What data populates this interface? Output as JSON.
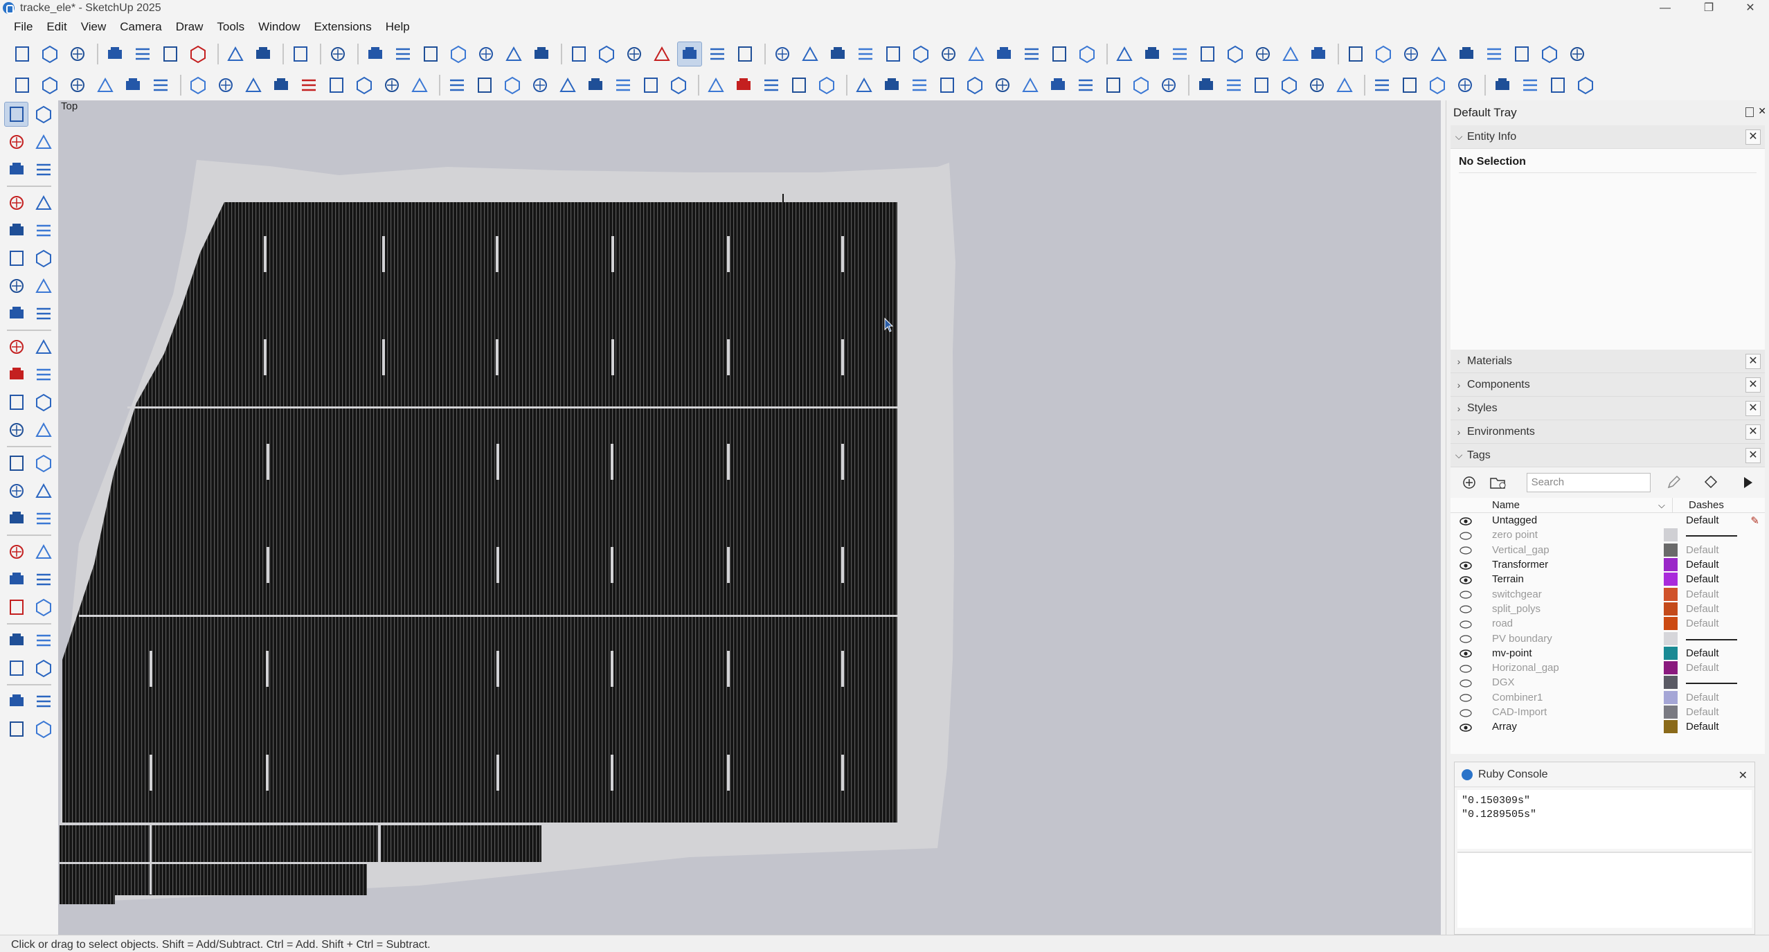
{
  "window": {
    "title": "tracke_ele* - SketchUp 2025",
    "minimize": "—",
    "maximize": "❐",
    "close": "✕"
  },
  "menu": [
    "File",
    "Edit",
    "View",
    "Camera",
    "Draw",
    "Tools",
    "Window",
    "Extensions",
    "Help"
  ],
  "toolbar_row1": [
    "new-file-icon",
    "open-file-icon",
    "save-icon",
    "|",
    "cut-icon",
    "copy-icon",
    "paste-icon",
    "delete-icon",
    "|",
    "undo-icon",
    "redo-icon",
    "|",
    "print-icon",
    "|",
    "model-info-icon",
    "|",
    "iso-view-icon",
    "top-view-icon",
    "front-view-icon",
    "right-view-icon",
    "back-view-icon",
    "left-view-icon",
    "bottom-view-icon",
    "|",
    "xray-icon",
    "back-edges-icon",
    "wireframe-icon",
    "hidden-line-icon",
    "shaded-icon",
    "shaded-textures-icon",
    "monochrome-icon",
    "|",
    "warehouse-icon",
    "text-icon",
    "tree-icon",
    "tower-icon",
    "compass-icon",
    "antenna-icon",
    "box-icon",
    "grid-icon",
    "placemark-icon",
    "scale-icon",
    "hide-icon",
    "section-icon",
    "|",
    "search-icon",
    "measure-angle-icon",
    "dimension-icon",
    "edit-icon",
    "arrows-icon",
    "list-icon",
    "lock-icon",
    "slope-icon",
    "|",
    "truss-icon",
    "house-icon",
    "table-icon",
    "layer-icon",
    "array-icon",
    "expand-icon",
    "export-icon",
    "cluster-icon",
    "rotate-icon"
  ],
  "toolbar_row2": [
    "menu-icon",
    "sun-icon",
    "globe-icon",
    "frame-icon",
    "terrain-icon",
    "mountain-icon",
    "|",
    "column-icon",
    "panel-icon",
    "panel-grid-icon",
    "panel-flat-icon",
    "trash-icon",
    "percent-icon",
    "sparkle-icon",
    "spark-icon",
    "pipe-icon",
    "|",
    "grid-select-icon",
    "display-icon",
    "cable-icon",
    "search-circle-icon",
    "route-icon",
    "zoom-icon",
    "ground-icon",
    "link-icon",
    "rack-icon",
    "|",
    "tripod-icon",
    "box-move-icon",
    "hospital-icon",
    "cloud-icon",
    "ruler-icon",
    "|",
    "split-icon",
    "image-icon",
    "road-icon",
    "cross-icon",
    "table-icon",
    "sliders-icon",
    "dropbox-icon",
    "database-icon",
    "money-icon",
    "kwh-icon",
    "irr-icon",
    "clipboard-icon",
    "|",
    "settings-icon",
    "settings-multi-icon",
    "edit-box-icon",
    "help-icon",
    "upload-icon",
    "refresh-icon",
    "|",
    "stack-icon",
    "loss-icon",
    "bi-icon",
    "play-icon",
    "|",
    "scale-tool-icon",
    "wrench-icon",
    "chart-icon",
    "sheet-icon"
  ],
  "left_toolbar": [
    [
      "select-icon",
      "lasso-icon"
    ],
    [
      "paint-icon",
      "eraser-icon"
    ],
    [
      "tag-tool-icon",
      "eraser-alt-icon"
    ],
    "-",
    [
      "line-icon",
      "freehand-icon"
    ],
    [
      "rectangle-icon",
      "rotated-rect-icon"
    ],
    [
      "circle-icon",
      "polygon-icon"
    ],
    [
      "arc-icon",
      "arc2-icon"
    ],
    [
      "pie-icon",
      "arc3-icon"
    ],
    "-",
    [
      "move-icon",
      "pushpull-icon"
    ],
    [
      "rotate-tool-icon",
      "followme-icon"
    ],
    [
      "scale-icon",
      "offset-icon"
    ],
    [
      "flip-icon",
      "mirror-icon"
    ],
    "-",
    [
      "tape-icon",
      "dimension-tool-icon"
    ],
    [
      "protractor-icon",
      "text-tool-icon"
    ],
    [
      "axes-icon",
      "3dtext-icon"
    ],
    "-",
    [
      "section-plane-icon",
      "pan-hand-icon"
    ],
    [
      "zoom-tool-icon",
      "zoom-window-icon"
    ],
    [
      "zoom-extents-icon",
      "previous-view-icon"
    ],
    "-",
    [
      "walk-icon",
      "position-camera-icon"
    ],
    [
      "look-around-icon",
      "sandbox-icon"
    ],
    "-",
    [
      "outliner-icon",
      "solid-icon"
    ],
    [
      "layers-icon",
      "layers2-icon"
    ]
  ],
  "viewport": {
    "view_label": "Top"
  },
  "tray": {
    "title": "Default Tray",
    "entity_info": {
      "label": "Entity Info",
      "selection": "No Selection"
    },
    "panels": [
      "Materials",
      "Components",
      "Styles",
      "Environments"
    ],
    "tags": {
      "label": "Tags",
      "search_placeholder": "Search",
      "col_name": "Name",
      "col_dashes": "Dashes",
      "rows": [
        {
          "name": "Untagged",
          "visible": true,
          "color": "",
          "dash": "Default"
        },
        {
          "name": "zero point",
          "visible": false,
          "color": "#d0d0d4",
          "dash": "line"
        },
        {
          "name": "Vertical_gap",
          "visible": false,
          "color": "#6a6a6a",
          "dash": "Default"
        },
        {
          "name": "Transformer",
          "visible": true,
          "color": "#9a27c8",
          "dash": "Default"
        },
        {
          "name": "Terrain",
          "visible": true,
          "color": "#a92bdb",
          "dash": "Default"
        },
        {
          "name": "switchgear",
          "visible": false,
          "color": "#d0522a",
          "dash": "Default"
        },
        {
          "name": "split_polys",
          "visible": false,
          "color": "#c44a1a",
          "dash": "Default"
        },
        {
          "name": "road",
          "visible": false,
          "color": "#cc4a12",
          "dash": "Default"
        },
        {
          "name": "PV boundary",
          "visible": false,
          "color": "#d6d6da",
          "dash": "line"
        },
        {
          "name": "mv-point",
          "visible": true,
          "color": "#1a8a94",
          "dash": "Default"
        },
        {
          "name": "Horizonal_gap",
          "visible": false,
          "color": "#8a1a7e",
          "dash": "Default"
        },
        {
          "name": "DGX",
          "visible": false,
          "color": "#5a5a64",
          "dash": "line"
        },
        {
          "name": "Combiner1",
          "visible": false,
          "color": "#a5a6d6",
          "dash": "Default"
        },
        {
          "name": "CAD-Import",
          "visible": false,
          "color": "#7a7a82",
          "dash": "Default"
        },
        {
          "name": "Array",
          "visible": true,
          "color": "#8a6a1a",
          "dash": "Default"
        }
      ]
    }
  },
  "ruby_console": {
    "title": "Ruby Console",
    "lines": [
      "\"0.150309s\"",
      "\"0.1289505s\""
    ]
  },
  "status": "Click or drag to select objects. Shift = Add/Subtract. Ctrl = Add. Shift + Ctrl = Subtract."
}
